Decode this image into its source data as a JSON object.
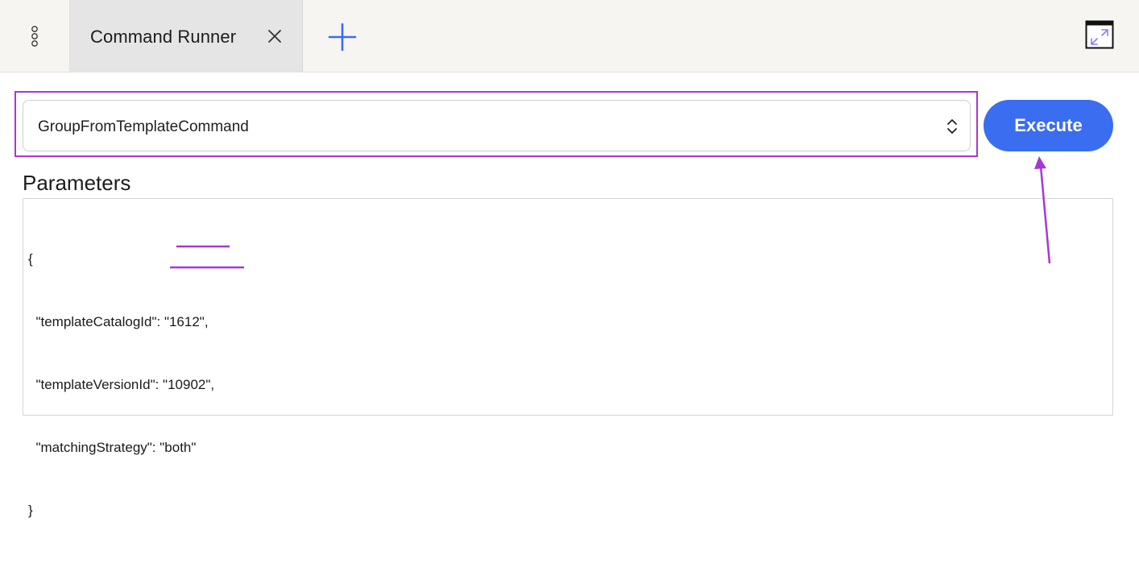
{
  "tabbar": {
    "menu_icon": "vertical-dots-icon",
    "active_tab": {
      "title": "Command Runner",
      "close_icon": "close-icon"
    },
    "add_tab_icon": "plus-icon",
    "maximize_icon": "expand-window-icon"
  },
  "command": {
    "selected": "GroupFromTemplateCommand",
    "chevron_icon": "select-chevrons-icon",
    "execute_label": "Execute"
  },
  "parameters": {
    "label": "Parameters",
    "lines": [
      "{",
      "  \"templateCatalogId\": \"1612\",",
      "  \"templateVersionId\": \"10902\",",
      "  \"matchingStrategy\": \"both\"",
      "}"
    ]
  },
  "colors": {
    "accent": "#3a6df0",
    "annotation": "#a737d4",
    "tab_active_bg": "#e5e5e6",
    "tabbar_bg": "#f7f5f2"
  }
}
